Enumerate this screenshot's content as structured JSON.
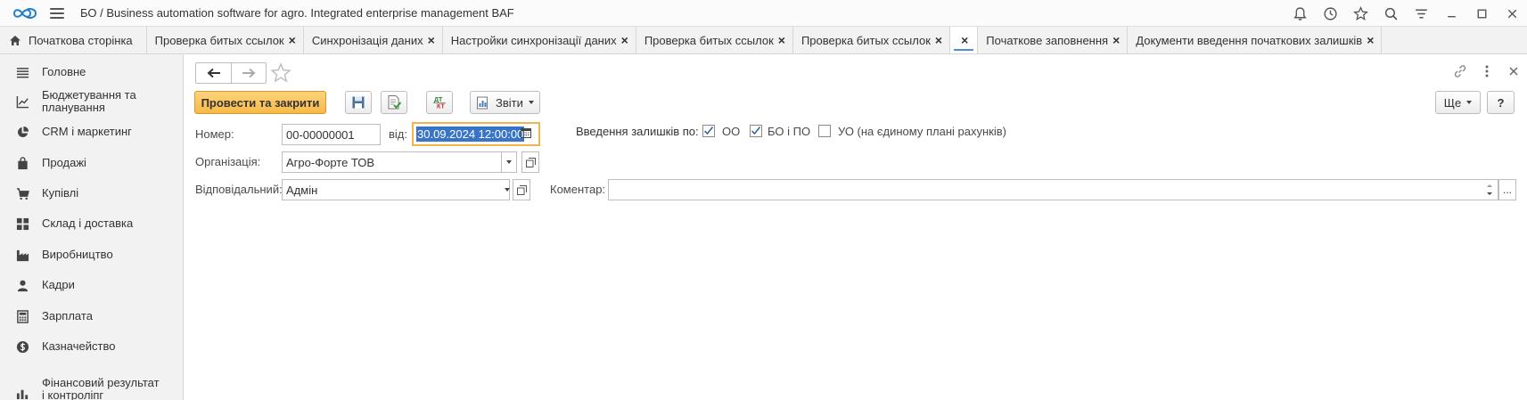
{
  "app": {
    "title": "БО / Business automation software for agro. Integrated enterprise management BAF"
  },
  "titlebar_icons": [
    "bell-icon",
    "history-icon",
    "star-icon",
    "search-icon",
    "filter-menu-icon",
    "minimize-icon",
    "maximize-icon",
    "close-icon"
  ],
  "tabs": [
    {
      "label": "Початкова сторінка",
      "home": true
    },
    {
      "label": "Проверка битых ссылок",
      "closable": true
    },
    {
      "label": "Синхронізація даних",
      "closable": true
    },
    {
      "label": "Настройки синхронізації даних",
      "closable": true
    },
    {
      "label": "Проверка битых ссылок",
      "closable": true
    },
    {
      "label": "Проверка битых ссылок",
      "closable": true
    },
    {
      "label": "",
      "closable": true,
      "active": true
    },
    {
      "label": "Початкове заповнення",
      "closable": true
    },
    {
      "label": "Документи введення початкових залишків",
      "closable": true
    }
  ],
  "tab_close_glyph": "×",
  "sidebar": {
    "items": [
      {
        "label": "Головне",
        "icon": "menu-lines-icon"
      },
      {
        "label": "Бюджетування та планування",
        "icon": "chart-line-icon"
      },
      {
        "label": "CRM і маркетинг",
        "icon": "pie-chart-icon"
      },
      {
        "label": "Продажі",
        "icon": "shopping-bag-icon"
      },
      {
        "label": "Купівлі",
        "icon": "cart-icon"
      },
      {
        "label": "Склад і доставка",
        "icon": "warehouse-icon"
      },
      {
        "label": "Виробництво",
        "icon": "factory-icon"
      },
      {
        "label": "Кадри",
        "icon": "person-icon"
      },
      {
        "label": "Зарплата",
        "icon": "calculator-icon"
      },
      {
        "label": "Казначейство",
        "icon": "coin-icon"
      },
      {
        "label": "Фінансовий результат і контроліпг",
        "icon": "bar-chart-icon"
      }
    ]
  },
  "toolbar": {
    "post_close_label": "Провести та закрити",
    "reports_label": "Звіти",
    "more_label": "Ще",
    "help_label": "?"
  },
  "form": {
    "number_label": "Номер:",
    "number_value": "00-00000001",
    "date_label": "від:",
    "date_value": "30.09.2024 12:00:00",
    "balances_label": "Введення залишків по:",
    "chk_oo_label": "ОО",
    "chk_oo_checked": true,
    "chk_bo_label": "БО і ПО",
    "chk_bo_checked": true,
    "chk_uo_label": "УО (на єдиному плані рахунків)",
    "chk_uo_checked": false,
    "org_label": "Організація:",
    "org_value": "Агро-Форте ТОВ",
    "resp_label": "Відповідальний:",
    "resp_value": "Адмін",
    "comment_label": "Коментар:",
    "comment_value": "",
    "ellipsis": "..."
  },
  "colors": {
    "primary_button": "#f5b94a",
    "selection": "#3874c8",
    "focus_border": "#f0b54e",
    "active_tab_underline": "#4a8fd8"
  }
}
